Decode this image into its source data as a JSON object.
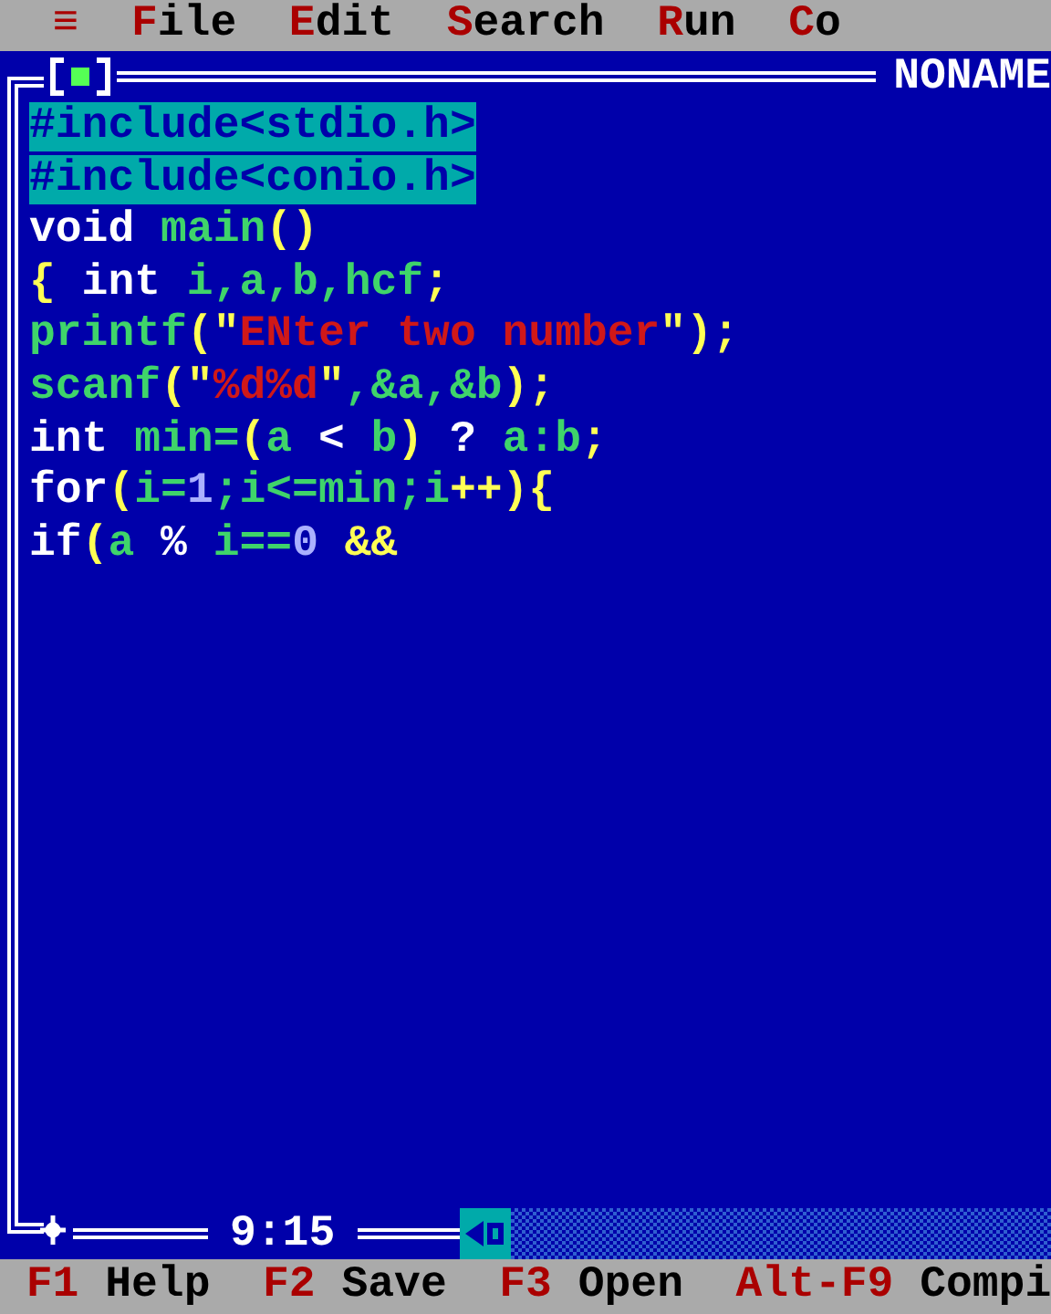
{
  "menu": [
    {
      "hotkey": "≡"
    },
    {
      "hotkey": "F",
      "rest": "ile"
    },
    {
      "hotkey": "E",
      "rest": "dit"
    },
    {
      "hotkey": "S",
      "rest": "earch"
    },
    {
      "hotkey": "R",
      "rest": "un"
    },
    {
      "hotkey": "C",
      "rest": "o"
    }
  ],
  "editor": {
    "title": "NONAME",
    "cursor_position": "9:15",
    "lines": [
      {
        "selected": true,
        "tokens": [
          {
            "text": "#include<stdio.h>"
          }
        ]
      },
      {
        "selected": true,
        "tokens": [
          {
            "text": "#include<conio.h>"
          }
        ]
      },
      {
        "selected": false,
        "tokens": [
          {
            "kind": "keyword",
            "text": "void"
          },
          {
            "kind": "ident",
            "text": " main"
          },
          {
            "kind": "punct",
            "text": "()"
          }
        ]
      },
      {
        "selected": false,
        "tokens": [
          {
            "kind": "punct",
            "text": "{"
          },
          {
            "kind": "keyword",
            "text": " int"
          },
          {
            "kind": "ident",
            "text": " i,a,b,hcf"
          },
          {
            "kind": "punct",
            "text": ";"
          }
        ]
      },
      {
        "selected": false,
        "tokens": [
          {
            "kind": "ident",
            "text": "printf"
          },
          {
            "kind": "punct",
            "text": "(\""
          },
          {
            "kind": "string",
            "text": "ENter two number"
          },
          {
            "kind": "punct",
            "text": "\");"
          }
        ]
      },
      {
        "selected": false,
        "tokens": [
          {
            "kind": "ident",
            "text": "scanf"
          },
          {
            "kind": "punct",
            "text": "(\""
          },
          {
            "kind": "string",
            "text": "%d%d"
          },
          {
            "kind": "punct",
            "text": "\""
          },
          {
            "kind": "ident",
            "text": ",&a,&b"
          },
          {
            "kind": "punct",
            "text": ");"
          }
        ]
      },
      {
        "selected": false,
        "tokens": [
          {
            "kind": "keyword",
            "text": "int"
          },
          {
            "kind": "ident",
            "text": " min="
          },
          {
            "kind": "punct",
            "text": "("
          },
          {
            "kind": "ident",
            "text": "a"
          },
          {
            "kind": "keyword",
            "text": " < "
          },
          {
            "kind": "ident",
            "text": "b"
          },
          {
            "kind": "punct",
            "text": ")"
          },
          {
            "kind": "keyword",
            "text": " ? "
          },
          {
            "kind": "ident",
            "text": "a:b"
          },
          {
            "kind": "punct",
            "text": ";"
          }
        ]
      },
      {
        "selected": false,
        "tokens": [
          {
            "kind": "keyword",
            "text": "for"
          },
          {
            "kind": "punct",
            "text": "("
          },
          {
            "kind": "ident",
            "text": "i="
          },
          {
            "kind": "number",
            "text": "1"
          },
          {
            "kind": "ident",
            "text": ";i<=min;i"
          },
          {
            "kind": "punct",
            "text": "++){"
          }
        ]
      },
      {
        "selected": false,
        "tokens": [
          {
            "kind": "keyword",
            "text": "if"
          },
          {
            "kind": "punct",
            "text": "("
          },
          {
            "kind": "ident",
            "text": "a"
          },
          {
            "kind": "keyword",
            "text": " % "
          },
          {
            "kind": "ident",
            "text": "i=="
          },
          {
            "kind": "number",
            "text": "0"
          },
          {
            "kind": "punct",
            "text": " &&"
          }
        ]
      }
    ]
  },
  "status_bar": [
    {
      "key": "F1",
      "label": "Help"
    },
    {
      "key": "F2",
      "label": "Save"
    },
    {
      "key": "F3",
      "label": "Open"
    },
    {
      "key": "Alt-F9",
      "label": "Compi"
    }
  ]
}
